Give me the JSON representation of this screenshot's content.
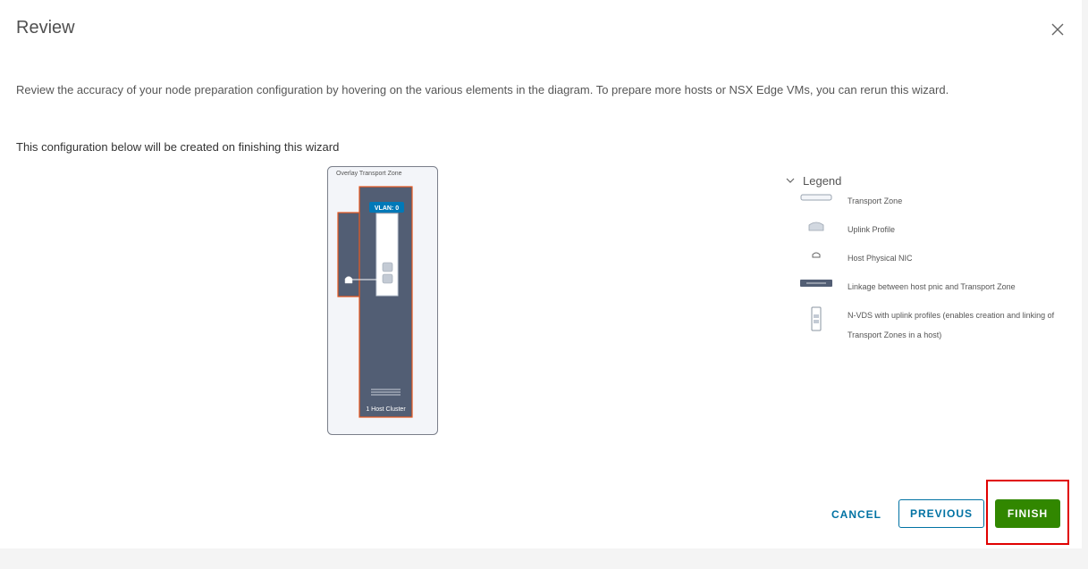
{
  "dialog": {
    "title": "Review",
    "description": "Review the accuracy of your node preparation configuration by hovering on the various elements in the diagram. To prepare more hosts or NSX Edge VMs, you can rerun this wizard.",
    "subheading": "This configuration below will be created on finishing this wizard"
  },
  "diagram": {
    "zone_label": "Overlay Transport Zone",
    "vlan_badge": "VLAN: 0",
    "cluster_label": "1 Host Cluster"
  },
  "legend": {
    "title": "Legend",
    "items": [
      {
        "icon": "transport-zone-icon",
        "label": "Transport Zone"
      },
      {
        "icon": "uplink-profile-icon",
        "label": "Uplink Profile"
      },
      {
        "icon": "host-physical-nic-icon",
        "label": "Host Physical NIC"
      },
      {
        "icon": "linkage-icon",
        "label": "Linkage between host pnic and Transport Zone"
      },
      {
        "icon": "nvds-icon",
        "label": "N-VDS with uplink profiles (enables creation and linking of Transport Zones in a host)"
      }
    ]
  },
  "footer": {
    "cancel_label": "CANCEL",
    "previous_label": "PREVIOUS",
    "finish_label": "FINISH"
  },
  "colors": {
    "primary": "#0072a3",
    "success": "#318700",
    "highlight": "#e00000",
    "cluster_fill": "#525e74",
    "cluster_border": "#e8571f"
  }
}
